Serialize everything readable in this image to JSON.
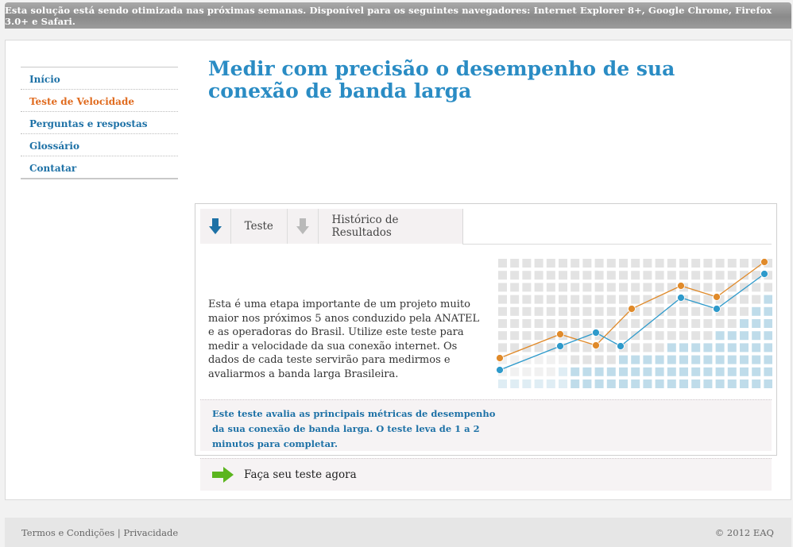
{
  "notice": "Esta solução está sendo otimizada nas próximas semanas. Disponível para os seguintes navegadores: Internet Explorer 8+, Google Chrome, Firefox 3.0+ e Safari.",
  "nav": {
    "items": [
      {
        "label": "Início"
      },
      {
        "label": "Teste de Velocidade",
        "active": true
      },
      {
        "label": "Perguntas e respostas"
      },
      {
        "label": "Glossário"
      },
      {
        "label": "Contatar"
      }
    ]
  },
  "main": {
    "title": "Medir com precisão o desempenho de sua conexão de banda larga",
    "tabs": [
      {
        "label": "Teste",
        "icon": "download-arrow-icon",
        "icon_color": "#1d71a6"
      },
      {
        "label": "Histórico de Resultados",
        "icon": "download-arrow-icon",
        "icon_color": "#b9b9b9"
      }
    ],
    "description": "Esta é uma etapa importante de um projeto muito maior nos próximos 5 anos conduzido pela ANATEL e as operadoras do Brasil. Utilize este teste para medir a velocidade da sua conexão internet. Os dados de cada teste servirão para medirmos e avaliarmos a banda larga Brasileira.",
    "info": "Este teste avalia as principais métricas de desempenho da sua conexão de banda larga. O teste leva de 1 a 2 minutos para completar.",
    "cta": "Faça seu teste agora"
  },
  "footer": {
    "terms": "Termos e Condições",
    "separator": "|",
    "privacy": "Privacidade",
    "copyright": "© 2012 EAQ"
  },
  "colors": {
    "accent_blue": "#2a8cc4",
    "link_blue": "#1d71a6",
    "active_orange": "#e06b1f",
    "graph_orange": "#e08a2a",
    "graph_blue": "#2e9acb",
    "cta_green": "#5bb51e"
  }
}
